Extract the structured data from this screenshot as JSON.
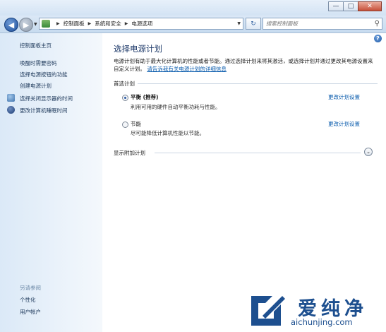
{
  "window": {
    "controls": {
      "minimize": "—",
      "maximize": "□",
      "close": "✕"
    }
  },
  "address_bar": {
    "crumbs": [
      "控制面板",
      "系统和安全",
      "电源选项"
    ],
    "search_placeholder": "搜索控制面板"
  },
  "sidebar": {
    "items": [
      "控制面板主页",
      "唤醒时需要密码",
      "选择电源按钮的功能",
      "创建电源计划",
      "选择关闭显示器的时间",
      "更改计算机睡眠时间"
    ],
    "see_also_heading": "另请参阅",
    "see_also_items": [
      "个性化",
      "用户帐户"
    ]
  },
  "main": {
    "title": "选择电源计划",
    "description": "电源计划有助于最大化计算机的性能或者节能。通过选择计划来将其激活，或选择计划并通过更改其电源设置来自定义计划。",
    "description_link": "请告诉我有关电源计划的详细信息",
    "preferred_heading": "首选计划",
    "plans": [
      {
        "name": "平衡 (推荐)",
        "description": "利用可用的硬件自动平衡功耗与性能。",
        "change_link": "更改计划设置",
        "selected": true
      },
      {
        "name": "节能",
        "description": "尽可能降低计算机性能以节能。",
        "change_link": "更改计划设置",
        "selected": false
      }
    ],
    "additional_heading": "显示附加计划"
  },
  "watermark": {
    "text": "爱纯净",
    "url": "aichunjing.com"
  },
  "colors": {
    "link": "#0b5cad",
    "title": "#1e3a6a",
    "sidebar_link": "#1e395b"
  }
}
